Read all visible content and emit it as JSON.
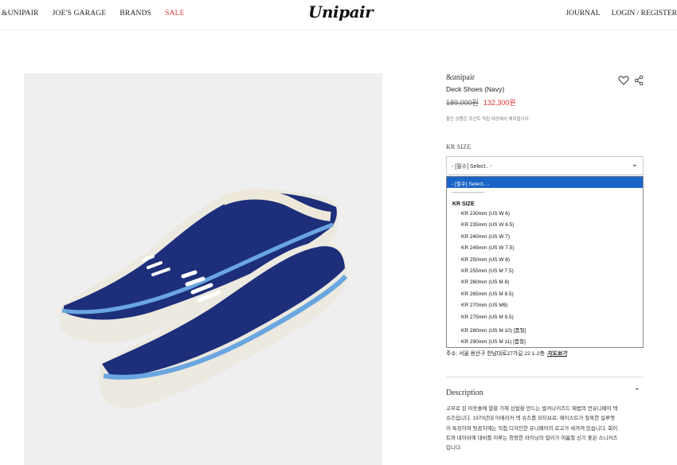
{
  "header": {
    "nav_left": [
      "&UNIPAIR",
      "JOE'S GARAGE",
      "BRANDS",
      "SALE"
    ],
    "logo": "Unipair",
    "journal": "JOURNAL",
    "login_register": "LOGIN / REGISTER"
  },
  "product": {
    "brand": "&unipair",
    "name": "Deck Shoes (Navy)",
    "original_price": "189,000원",
    "sale_price": "132,300원",
    "note": "할인 상품은 포인트 적립 대상에서 제외됩니다.",
    "image_icon": "navy-deck-shoes-image"
  },
  "size": {
    "label": "KR SIZE",
    "select_value": "- [필수] Select.. -",
    "dropdown": {
      "selected": "- [필수] Select.. -",
      "separator": "-------------------",
      "group": "KR SIZE",
      "options": [
        "KR 230mm (US W 6)",
        "KR 235mm (US W 6.5)",
        "KR 240mm (US W 7)",
        "KR 245mm (US W 7.5)",
        "KR 250mm (US W 8)",
        "KR 255mm (US M 7.5)",
        "KR 260mm (US M 8)",
        "KR 265mm (US M 8.5)",
        "KR 270mm (US M9)",
        "KR 275mm (US M 9.5)",
        "KR 280mm (US M 10) [품절]",
        "KR 290mm (US M 11) [품절]"
      ]
    }
  },
  "address": {
    "text": "주소: 서울 용산구 한남대로27가길 22 1-2층",
    "map_link": "지도보기"
  },
  "description": {
    "title": "Description",
    "lines": [
      "고무로 된 아웃솔에 열을 가해 신발을 만드는 벌커나이즈드 제법의 언유니페어 덱",
      "슈즈입니다. 1970년대 아메리카 덱 슈즈를 모티브로, 웨이스트가 절록한 실루엣",
      "이 특징이며 뒷꿈치에는 직접 디자인한 유니페어의 로고가 새겨져 있습니다. 화이",
      "트와 네이비에 대비를 이루는 청량한 라이닝의 컬러가 여름철 신기 좋은 스니커즈",
      "입니다."
    ]
  },
  "colors": {
    "sale": "#dd3333",
    "dropdown_highlight": "#1a64c7",
    "shoe_navy": "#1d2f7a",
    "sole_blue": "#6aa6e0"
  }
}
